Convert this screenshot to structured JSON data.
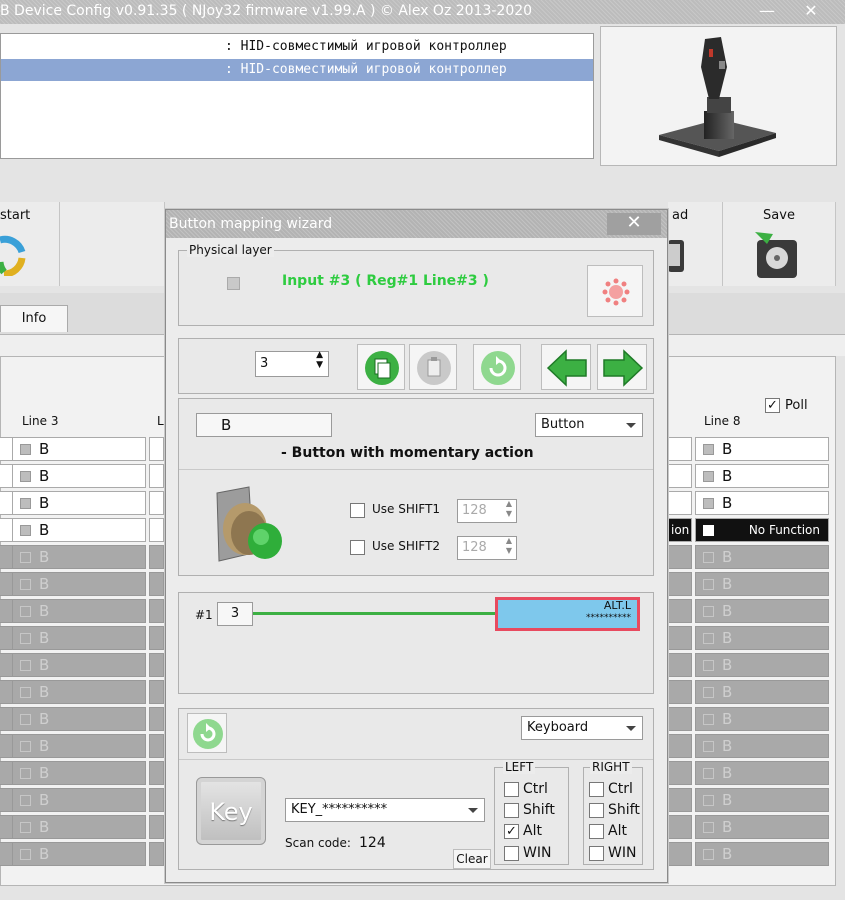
{
  "window": {
    "title": "B Device Config v0.91.35 ( NJoy32 firmware v1.99.A ) © Alex Oz 2013-2020",
    "minimize": "—",
    "close": "✕"
  },
  "devices": [
    {
      "text": ": HID-совместимый игровой контроллер"
    },
    {
      "text": ": HID-совместимый игровой контроллер"
    }
  ],
  "toolbar": {
    "restart_label": "start",
    "load_label": "ad",
    "save_label": "Save"
  },
  "tabs": {
    "info": "Info"
  },
  "grid": {
    "headers": {
      "line3": "Line 3",
      "line8": "Line 8",
      "poll": "Poll"
    },
    "poll_checked": true,
    "value_label": "B",
    "no_function": "No Function",
    "no_function_short": "ion"
  },
  "dialog": {
    "title": "Button mapping wizard",
    "close": "✕",
    "physical_layer_label": "Physical layer",
    "input_status": "Input #3  ( Reg#1  Line#3 )",
    "spinner_value": "3",
    "button_name": "B",
    "mode_value": "Button",
    "mode_description": "- Button with momentary action",
    "shift1_label": "Use SHIFT1",
    "shift1_value": "128",
    "shift2_label": "Use SHIFT2",
    "shift2_value": "128",
    "channel_label": "#1",
    "channel_value": "3",
    "output_name": "ALT.L",
    "output_sub": "**********",
    "output_type_value": "Keyboard",
    "key_label": "Key",
    "key_value": "KEY_**********",
    "scan_code_label": "Scan code:",
    "scan_code_value": "124",
    "clear_label": "Clear",
    "left_group": "LEFT",
    "right_group": "RIGHT",
    "mods": {
      "ctrl": "Ctrl",
      "shift": "Shift",
      "alt": "Alt",
      "win": "WIN"
    },
    "left_alt_checked": true
  },
  "colors": {
    "accent_green": "#3cb043",
    "led_green": "#2ecc40",
    "output_blue": "#7ec8ec",
    "output_border": "#e84a5f"
  }
}
